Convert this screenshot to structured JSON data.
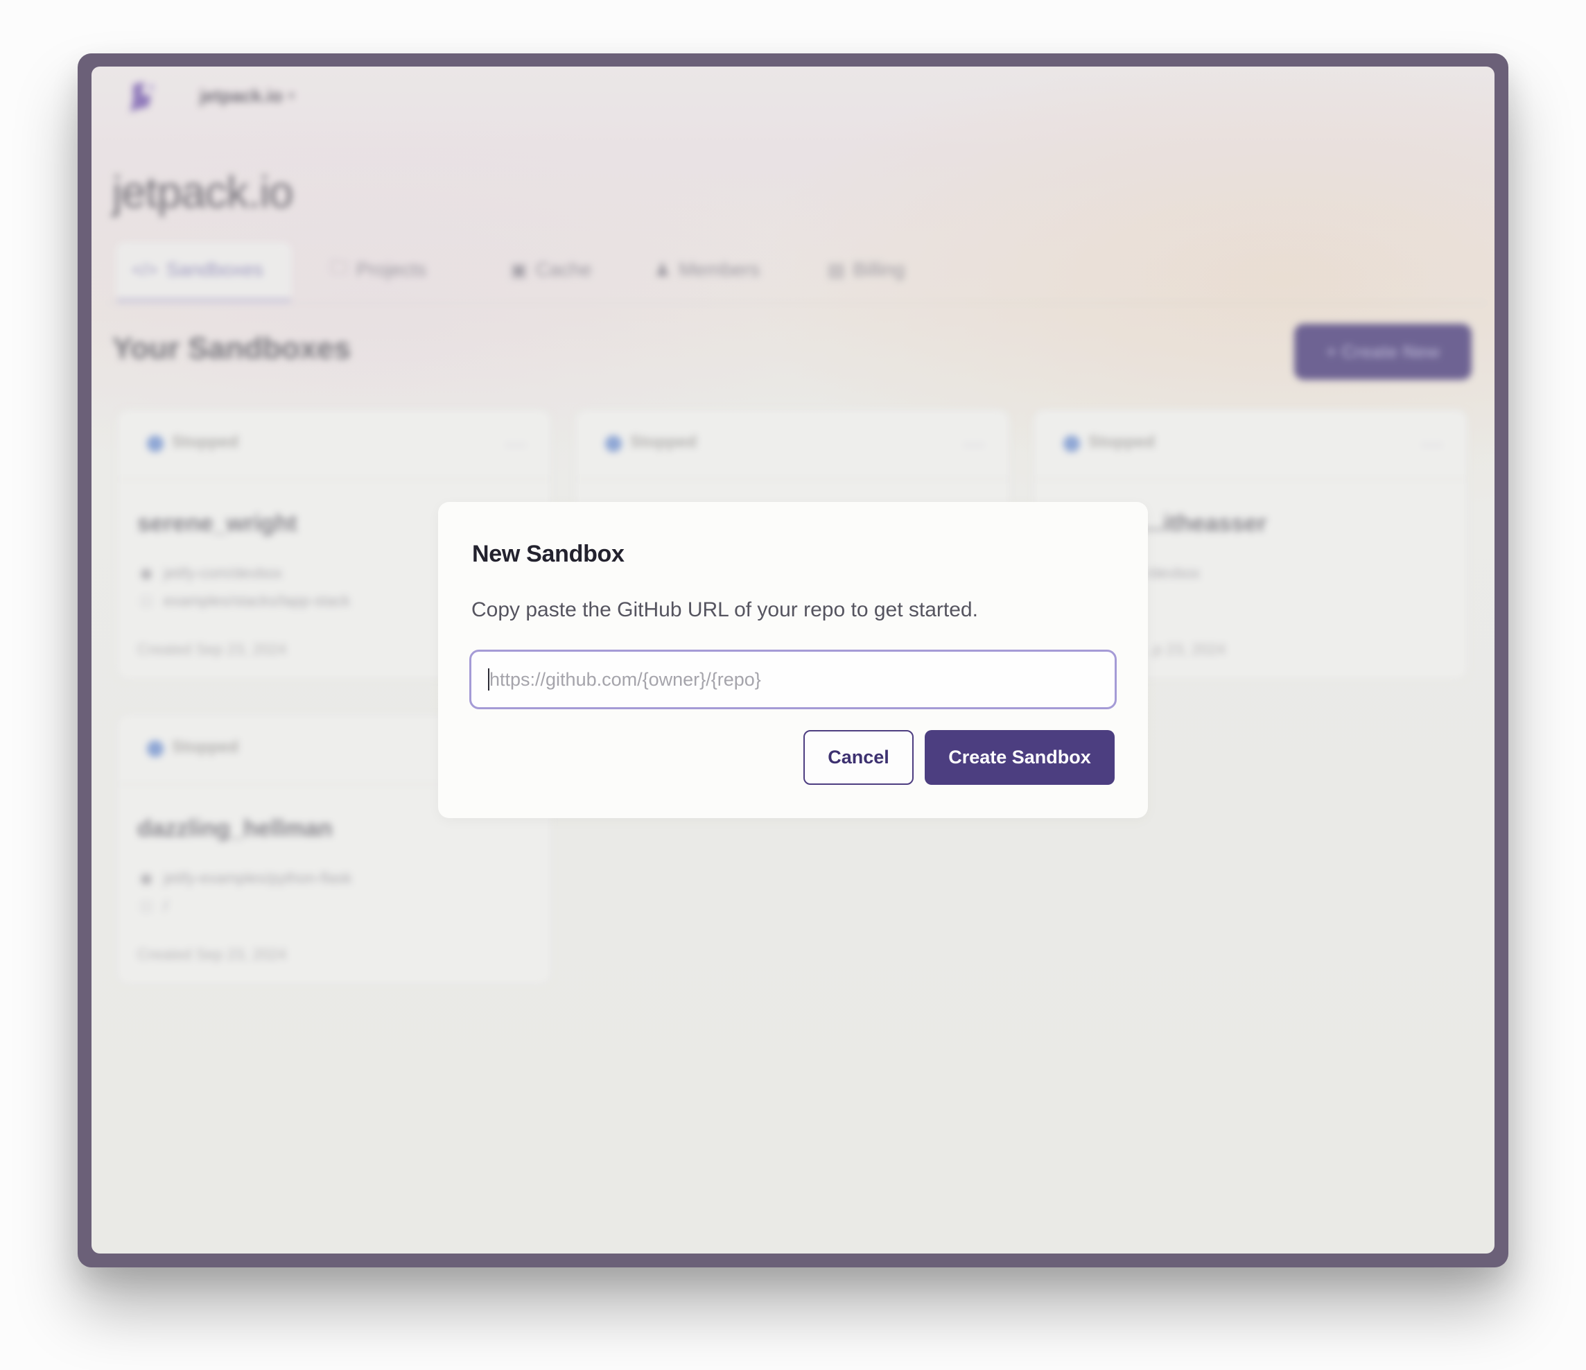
{
  "colors": {
    "frame": "#6b6078",
    "accent": "#4c3e80",
    "input_focus_border": "#a59bd6",
    "status_stopped": "#7b98d0"
  },
  "header": {
    "logo_icon": "jetpack-logo-icon",
    "org_name": "jetpack.io",
    "org_chevron_icon": "chevron-down-icon",
    "icons": [
      "help-circle-icon",
      "moon-icon",
      "user-avatar-icon"
    ]
  },
  "page": {
    "title": "jetpack.io",
    "tabs": [
      {
        "label": "Sandboxes",
        "icon": "code-icon",
        "active": true
      },
      {
        "label": "Projects",
        "icon": "folder-icon",
        "active": false
      },
      {
        "label": "Cache",
        "icon": "database-icon",
        "active": false
      },
      {
        "label": "Members",
        "icon": "users-icon",
        "active": false
      },
      {
        "label": "Billing",
        "icon": "credit-card-icon",
        "active": false
      }
    ],
    "section_title": "Your Sandboxes",
    "create_new_label": "+ Create New"
  },
  "sandboxes": [
    {
      "status": "Stopped",
      "name": "serene_wright",
      "repo": "jetify-com/devbox",
      "path": "examples/stacks/lapp-stack",
      "created": "Created Sep 23, 2024"
    },
    {
      "status": "Stopped",
      "name": "",
      "repo": "",
      "path": "",
      "created": ""
    },
    {
      "status": "Stopped",
      "name": "…itheasser",
      "repo": "…/devbox",
      "path": "",
      "created": "…p 23, 2024"
    },
    {
      "status": "Stopped",
      "name": "dazzling_hellman",
      "repo": "jetify-examples/python-flask",
      "path": "/",
      "created": "Created Sep 23, 2024"
    }
  ],
  "dialog": {
    "title": "New Sandbox",
    "description": "Copy paste the GitHub URL of your repo to get started.",
    "input_value": "",
    "input_placeholder": "https://github.com/{owner}/{repo}",
    "cancel_label": "Cancel",
    "create_label": "Create Sandbox"
  }
}
